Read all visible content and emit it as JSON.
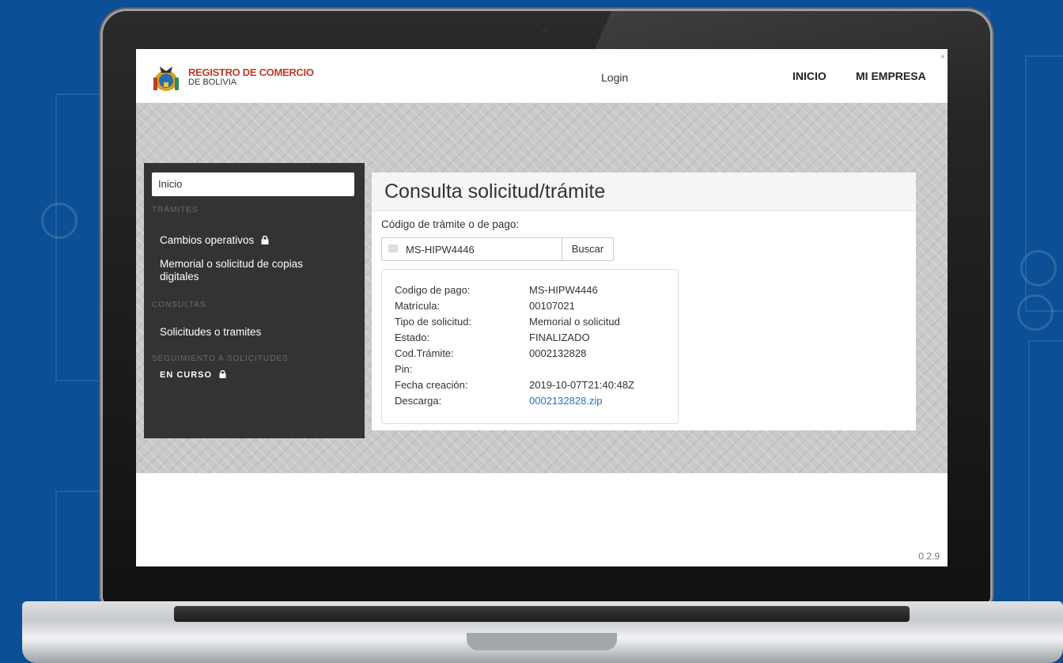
{
  "header": {
    "logo_title": "REGISTRO DE COMERCIO",
    "logo_subtitle": "DE BOLIVIA",
    "login": "Login",
    "nav": [
      "INICIO",
      "MI EMPRESA"
    ]
  },
  "sidebar": {
    "home": "Inicio",
    "sections": [
      {
        "title": "TRÁMITES",
        "items": [
          {
            "label": "Cambios operativos",
            "locked": true
          },
          {
            "label": "Memorial o solicitud de copias digitales",
            "locked": false
          }
        ]
      },
      {
        "title": "CONSULTAS",
        "items": [
          {
            "label": "Solicitudes o tramites",
            "locked": false
          }
        ]
      },
      {
        "title": "SEGUIMIENTO A SOLICITUDES",
        "items": [
          {
            "label": "EN CURSO",
            "locked": true
          }
        ]
      }
    ]
  },
  "main": {
    "title": "Consulta solicitud/trámite",
    "code_label": "Código de trámite o de pago:",
    "search_value": "MS-HIPW4446",
    "search_button": "Buscar",
    "result": [
      {
        "label": "Codigo de pago:",
        "value": "MS-HIPW4446"
      },
      {
        "label": "Matrícula:",
        "value": "00107021"
      },
      {
        "label": "Tipo de solicitud:",
        "value": "Memorial o solicitud"
      },
      {
        "label": "Estado:",
        "value": "FINALIZADO"
      },
      {
        "label": "Cod.Trámite:",
        "value": "0002132828"
      },
      {
        "label": "Pin:",
        "value": ""
      },
      {
        "label": "Fecha creación:",
        "value": "2019-10-07T21:40:48Z"
      },
      {
        "label": "Descarga:",
        "value": "0002132828.zip",
        "link": true
      }
    ]
  },
  "footer": {
    "version": "0.2.9"
  },
  "colors": {
    "background": "#0b4f96",
    "sidebar": "#333333",
    "brand_red": "#c0392b",
    "link": "#2a6fc9"
  },
  "icons": [
    "coat-of-arms-icon",
    "lock-icon",
    "card-icon"
  ]
}
